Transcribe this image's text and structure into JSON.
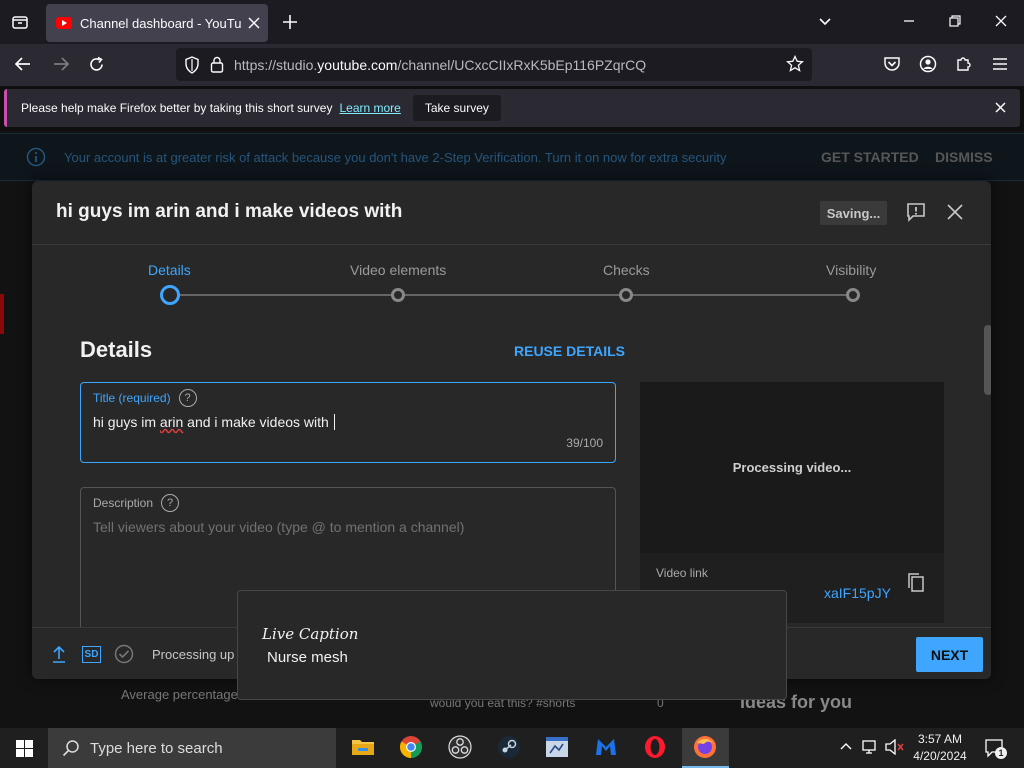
{
  "browser": {
    "tab_title": "Channel dashboard - YouTube Studio",
    "url_prefix": "https://studio.",
    "url_domain": "youtube.com",
    "url_path": "/channel/UCxcCIIxRxK5bEp116PZqrCQ",
    "survey_text": "Please help make Firefox better by taking this short survey",
    "survey_link": "Learn more",
    "survey_button": "Take survey"
  },
  "warning": {
    "text": "Your account is at greater risk of attack because you don't have 2-Step Verification. Turn it on now for extra security",
    "get_started": "GET STARTED",
    "dismiss": "DISMISS"
  },
  "dialog": {
    "title": "hi guys im arin and i make videos with",
    "saving": "Saving...",
    "steps": [
      "Details",
      "Video elements",
      "Checks",
      "Visibility"
    ],
    "details_heading": "Details",
    "reuse_details": "REUSE DETAILS",
    "title_field": {
      "label": "Title (required)",
      "value_start": "hi guys im ",
      "value_misspelled": "arin",
      "value_end": " and i make videos with ",
      "counter": "39/100"
    },
    "description_field": {
      "label": "Description",
      "placeholder": "Tell viewers about your video (type @ to mention a channel)"
    },
    "preview_status": "Processing video...",
    "video_link_label": "Video link",
    "video_link_visible": "xaIF15pJY",
    "footer_status": "Processing up",
    "next_button": "NEXT"
  },
  "background": {
    "avg_percentage": "Average percentage",
    "shorts_title": "would you eat this? #shorts",
    "shorts_value": "0",
    "ideas": "Ideas for you"
  },
  "live_caption": {
    "title": "Live Caption",
    "text": "Nurse mesh"
  },
  "taskbar": {
    "search_placeholder": "Type here to search",
    "time": "3:57 AM",
    "date": "4/20/2024",
    "notification_count": "1"
  },
  "colors": {
    "accent_blue": "#3ea6ff",
    "dialog_bg": "#282828",
    "youtube_red": "#ff0000"
  }
}
